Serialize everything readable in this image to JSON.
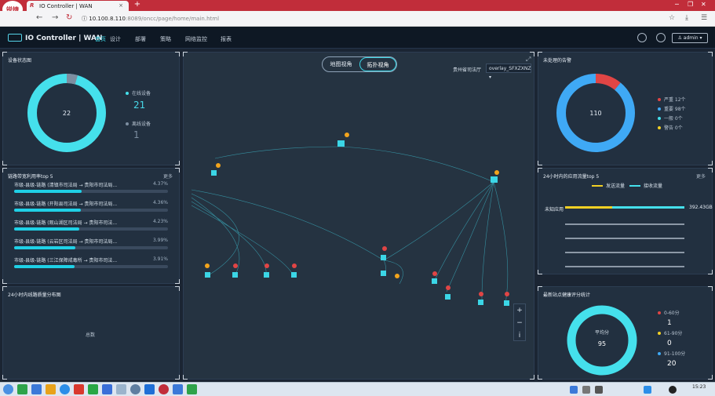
{
  "browser": {
    "tab_title": "IO Controller | WAN",
    "tab_logo_letter": "R",
    "close_glyph": "×",
    "new_tab_glyph": "+",
    "logo_text": "锐捷",
    "url_host": "10.100.8.110",
    "url_rest": ":8089/oncc/page/home/main.html"
  },
  "app": {
    "title": "IO Controller | WAN",
    "nav": [
      "首页",
      "设计",
      "部署",
      "策略",
      "网络监控",
      "报表"
    ],
    "active_nav": 0,
    "user": "admin"
  },
  "device_status": {
    "title": "设备状态图",
    "total": "22",
    "online_label": "在线设备",
    "online_count": "21",
    "offline_label": "离线设备",
    "offline_count": "1",
    "colors": {
      "online": "#45e0ec",
      "offline": "#7d8ea1"
    }
  },
  "bandwidth_top5": {
    "title": "链路带宽利用率top 5",
    "more": "更多",
    "items": [
      {
        "label": "市级-县级-链路 (清镇市司法局 → 贵阳市司法局...",
        "pct": "4.37%",
        "value": 4.37
      },
      {
        "label": "市级-县级-链路 (开阳县司法局 → 贵阳市司法局...",
        "pct": "4.36%",
        "value": 4.36
      },
      {
        "label": "市级-县级-链路 (观山湖区司法局 → 贵阳市司法...",
        "pct": "4.23%",
        "value": 4.23
      },
      {
        "label": "市级-县级-链路 (云岩区司法局 → 贵阳市司法局...",
        "pct": "3.99%",
        "value": 3.99
      },
      {
        "label": "市级-县级-链路 (三江保障戒毒所 → 贵阳市司法...",
        "pct": "3.91%",
        "value": 3.91
      }
    ]
  },
  "link_quality": {
    "title": "24小时内线路质量分布图",
    "center_label": "总数"
  },
  "map": {
    "toggle": [
      "地图视角",
      "拓扑视角"
    ],
    "active_toggle": 1,
    "select_label": "贵州省司法厅",
    "select_value": "overlay_SFXZXNZ"
  },
  "alarms": {
    "title": "未处理的告警",
    "total": "110",
    "legend": [
      {
        "label": "严重 12个",
        "color": "#e04545",
        "value": 12
      },
      {
        "label": "重要 98个",
        "color": "#3fa9f5",
        "value": 98
      },
      {
        "label": "一般 0个",
        "color": "#45e0ec",
        "value": 0
      },
      {
        "label": "警告 0个",
        "color": "#f2d024",
        "value": 0
      }
    ]
  },
  "app_traffic": {
    "title": "24小时内的应用流量top 5",
    "more": "更多",
    "send_label": "发送流量",
    "recv_label": "接收流量",
    "colors": {
      "send": "#f2d024",
      "recv": "#45e0ec"
    },
    "first_app": "未知应用",
    "first_value": "392.43GB"
  },
  "health": {
    "title": "最新站点健康评分统计",
    "center_label": "平均分",
    "center_value": "95",
    "legend": [
      {
        "label": "0-60分",
        "count": "1",
        "color": "#e04545"
      },
      {
        "label": "61-90分",
        "count": "0",
        "color": "#f2d024"
      },
      {
        "label": "91-100分",
        "count": "20",
        "color": "#3fa9f5"
      }
    ]
  },
  "taskbar": {
    "time": "15:23"
  }
}
